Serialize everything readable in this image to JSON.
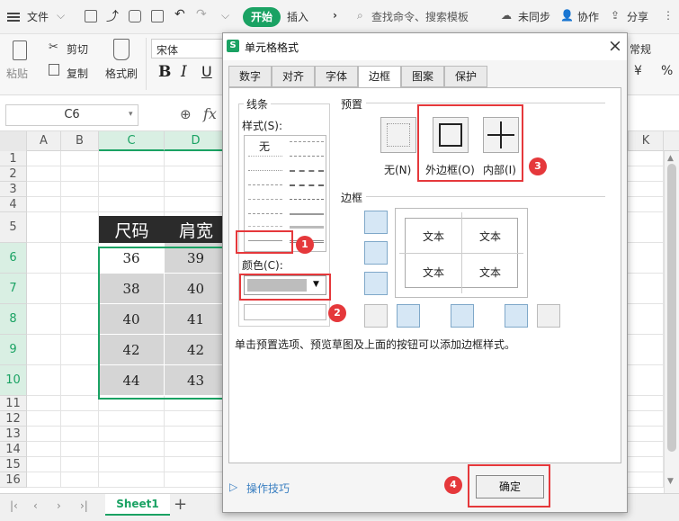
{
  "menu": {
    "file": "文件",
    "start": "开始",
    "insert": "插入",
    "more": "›",
    "search": "查找命令、搜索模板",
    "unsync": "未同步",
    "collab": "协作",
    "share": "分享"
  },
  "ribbon": {
    "cut": "剪切",
    "paste": "粘贴",
    "copy": "复制",
    "format_painter": "格式刷",
    "font": "宋体",
    "bold": "B",
    "italic": "I",
    "underline": "U",
    "normal": "常规",
    "yen": "¥",
    "percent": "%"
  },
  "formula": {
    "cell_ref": "C6",
    "fx": "fx"
  },
  "grid": {
    "columns": [
      "A",
      "B",
      "C",
      "D",
      "K"
    ],
    "rows": [
      "1",
      "2",
      "3",
      "4",
      "5",
      "6",
      "7",
      "8",
      "9",
      "10",
      "11",
      "12",
      "13",
      "14",
      "15",
      "16"
    ],
    "header": [
      "尺码",
      "肩宽"
    ],
    "data": [
      [
        "36",
        "39"
      ],
      [
        "38",
        "40"
      ],
      [
        "40",
        "41"
      ],
      [
        "42",
        "42"
      ],
      [
        "44",
        "43"
      ]
    ]
  },
  "sheet": {
    "tab": "Sheet1",
    "add": "+"
  },
  "dialog": {
    "title": "单元格格式",
    "close": "×",
    "tabs": [
      "数字",
      "对齐",
      "字体",
      "边框",
      "图案",
      "保护"
    ],
    "line_group": "线条",
    "style_label": "样式(S):",
    "none_style": "无",
    "color_label": "颜色(C):",
    "preset_group": "预置",
    "preset_none": "无(N)",
    "preset_outline": "外边框(O)",
    "preset_inside": "内部(I)",
    "border_group": "边框",
    "preview_text": [
      "文本",
      "文本",
      "文本",
      "文本"
    ],
    "hint": "单击预置选项、预览草图及上面的按钮可以添加边框样式。",
    "tips": "操作技巧",
    "ok": "确定"
  },
  "badges": [
    "1",
    "2",
    "3",
    "4"
  ]
}
